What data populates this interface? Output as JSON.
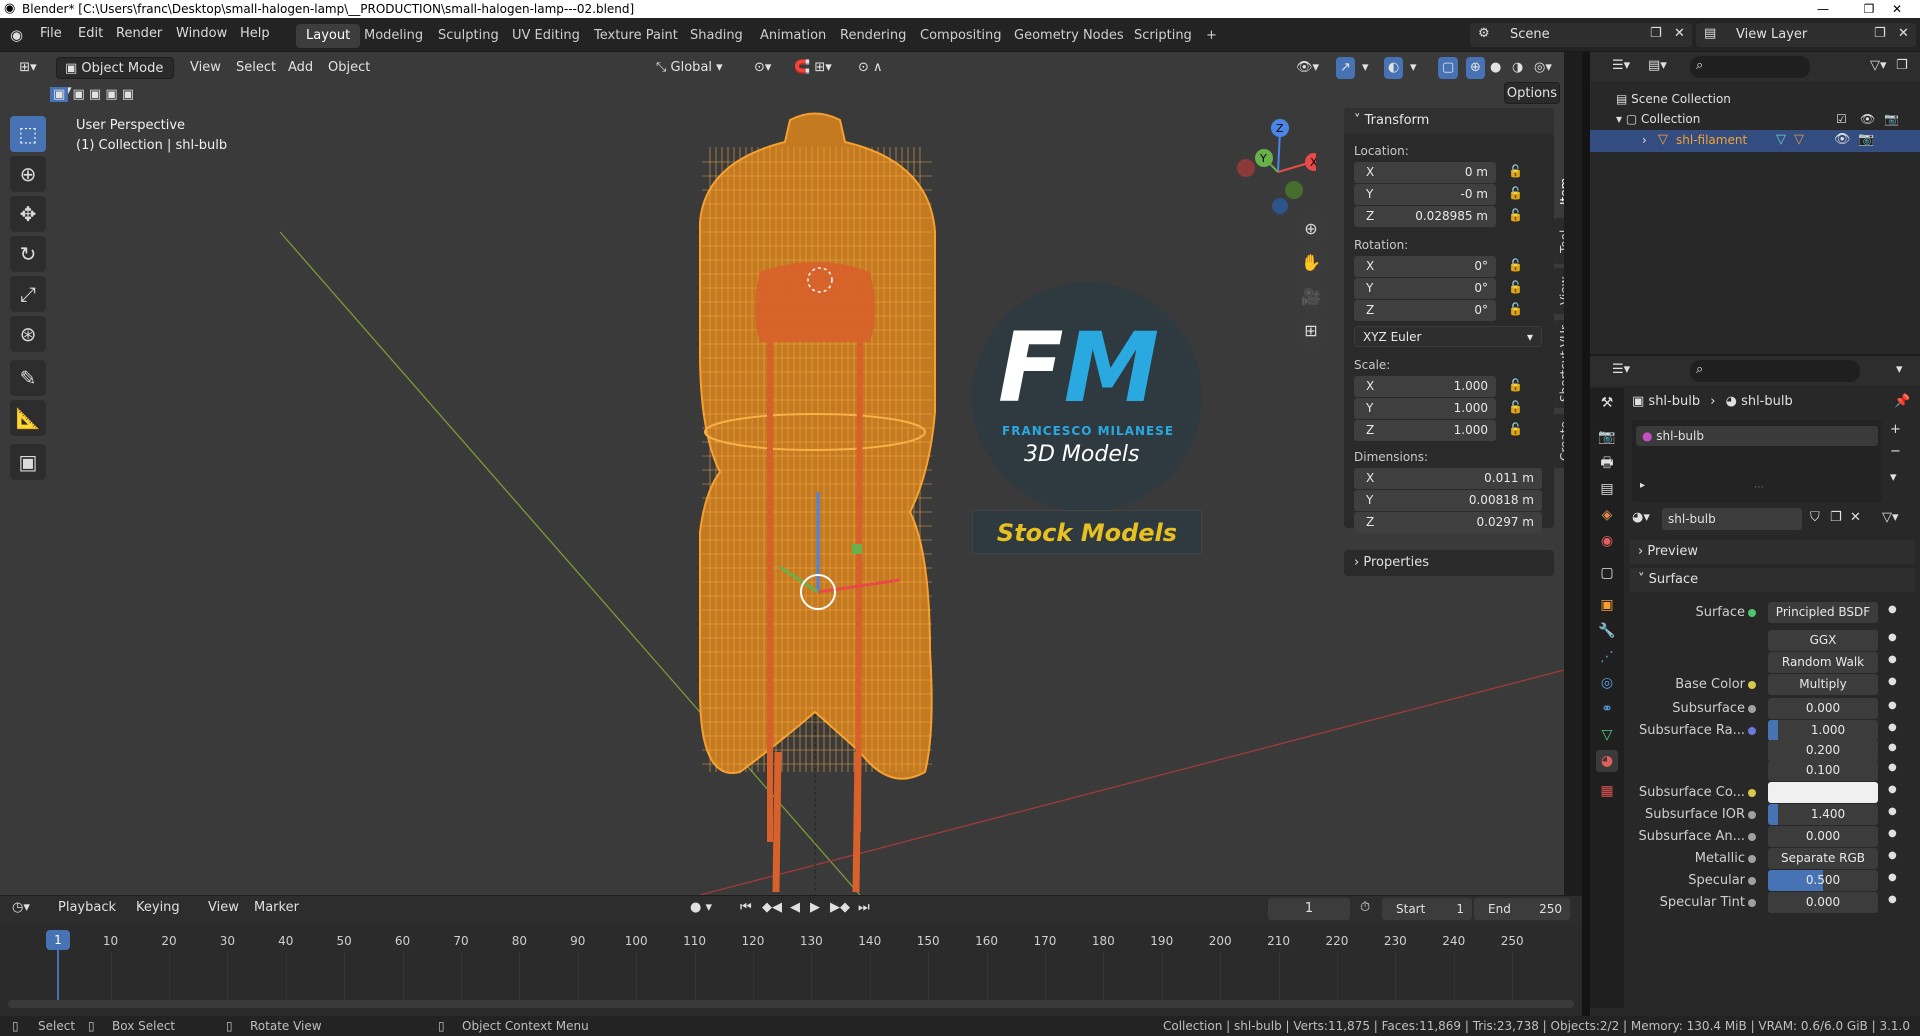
{
  "window": {
    "title": "Blender* [C:\\Users\\franc\\Desktop\\small-halogen-lamp\\__PRODUCTION\\small-halogen-lamp---02.blend]"
  },
  "menu": [
    "File",
    "Edit",
    "Render",
    "Window",
    "Help"
  ],
  "workspaces": [
    "Layout",
    "Modeling",
    "Sculpting",
    "UV Editing",
    "Texture Paint",
    "Shading",
    "Animation",
    "Rendering",
    "Compositing",
    "Geometry Nodes",
    "Scripting",
    "+"
  ],
  "scene": {
    "label": "Scene",
    "view_layer": "View Layer"
  },
  "viewport": {
    "mode": "Object Mode",
    "menus": [
      "View",
      "Select",
      "Add",
      "Object"
    ],
    "orientation": "Global",
    "options": "Options",
    "overlay_title": "User Perspective",
    "overlay_sub": "(1) Collection | shl-bulb",
    "axes": [
      "X",
      "Y",
      "Z"
    ]
  },
  "watermark": {
    "logo_letters": "FM",
    "name": "FRANCESCO MILANESE",
    "subtitle": "3D Models",
    "banner": "Stock Models"
  },
  "npanel": {
    "header": "Transform",
    "location_label": "Location:",
    "location": [
      {
        "k": "X",
        "v": "0 m"
      },
      {
        "k": "Y",
        "v": "-0 m"
      },
      {
        "k": "Z",
        "v": "0.028985 m"
      }
    ],
    "rotation_label": "Rotation:",
    "rotation": [
      {
        "k": "X",
        "v": "0°"
      },
      {
        "k": "Y",
        "v": "0°"
      },
      {
        "k": "Z",
        "v": "0°"
      }
    ],
    "rotation_mode": "XYZ Euler",
    "scale_label": "Scale:",
    "scale": [
      {
        "k": "X",
        "v": "1.000"
      },
      {
        "k": "Y",
        "v": "1.000"
      },
      {
        "k": "Z",
        "v": "1.000"
      }
    ],
    "dimensions_label": "Dimensions:",
    "dimensions": [
      {
        "k": "X",
        "v": "0.011 m"
      },
      {
        "k": "Y",
        "v": "0.00818 m"
      },
      {
        "k": "Z",
        "v": "0.0297 m"
      }
    ],
    "properties": "Properties",
    "tabs": [
      "Item",
      "Tool",
      "View",
      "Shortcut VUr",
      "Create"
    ]
  },
  "outliner": {
    "root": "Scene Collection",
    "collection": "Collection",
    "object": "shl-filament"
  },
  "properties": {
    "breadcrumb_obj": "shl-bulb",
    "breadcrumb_mat": "shl-bulb",
    "material_slot": "shl-bulb",
    "material_name": "shl-bulb",
    "preview": "Preview",
    "surface_section": "Surface",
    "rows": [
      {
        "label": "Surface",
        "value": "Principled BSDF",
        "dot": "#4ec46e"
      },
      {
        "label": "",
        "value": "GGX",
        "dot": ""
      },
      {
        "label": "",
        "value": "Random Walk",
        "dot": ""
      },
      {
        "label": "Base Color",
        "value": "Multiply",
        "dot": "#d8c84a"
      },
      {
        "label": "Subsurface",
        "value": "0.000",
        "dot": "#a0a0a0"
      },
      {
        "label": "Subsurface Ra...",
        "value": "1.000",
        "dot": "#6a7ad8"
      },
      {
        "label": "",
        "value": "0.200",
        "dot": ""
      },
      {
        "label": "",
        "value": "0.100",
        "dot": ""
      },
      {
        "label": "Subsurface Co...",
        "value": "",
        "dot": "#d8c84a"
      },
      {
        "label": "Subsurface IOR",
        "value": "1.400",
        "dot": "#a0a0a0"
      },
      {
        "label": "Subsurface An...",
        "value": "0.000",
        "dot": "#a0a0a0"
      },
      {
        "label": "Metallic",
        "value": "Separate RGB",
        "dot": "#a0a0a0"
      },
      {
        "label": "Specular",
        "value": "0.500",
        "dot": "#a0a0a0"
      },
      {
        "label": "Specular Tint",
        "value": "0.000",
        "dot": "#a0a0a0"
      }
    ]
  },
  "timeline": {
    "menus": [
      "Playback",
      "Keying",
      "View",
      "Marker"
    ],
    "current_frame": "1",
    "start_label": "Start",
    "start": "1",
    "end_label": "End",
    "end": "250",
    "ticks": [
      "1",
      "10",
      "20",
      "30",
      "40",
      "50",
      "60",
      "70",
      "80",
      "90",
      "100",
      "110",
      "120",
      "130",
      "140",
      "150",
      "160",
      "170",
      "180",
      "190",
      "200",
      "210",
      "220",
      "230",
      "240",
      "250"
    ]
  },
  "status": {
    "select": "Select",
    "box_select": "Box Select",
    "rotate": "Rotate View",
    "context": "Object Context Menu",
    "stats": "Collection | shl-bulb | Verts:11,875 | Faces:11,869 | Tris:23,738 | Objects:2/2 | Memory: 130.4 MiB | VRAM: 0.6/6.0 GiB | 3.1.0"
  },
  "colors": {
    "accent": "#4772b3",
    "wire": "#f5a030",
    "selected": "#e8742c"
  }
}
